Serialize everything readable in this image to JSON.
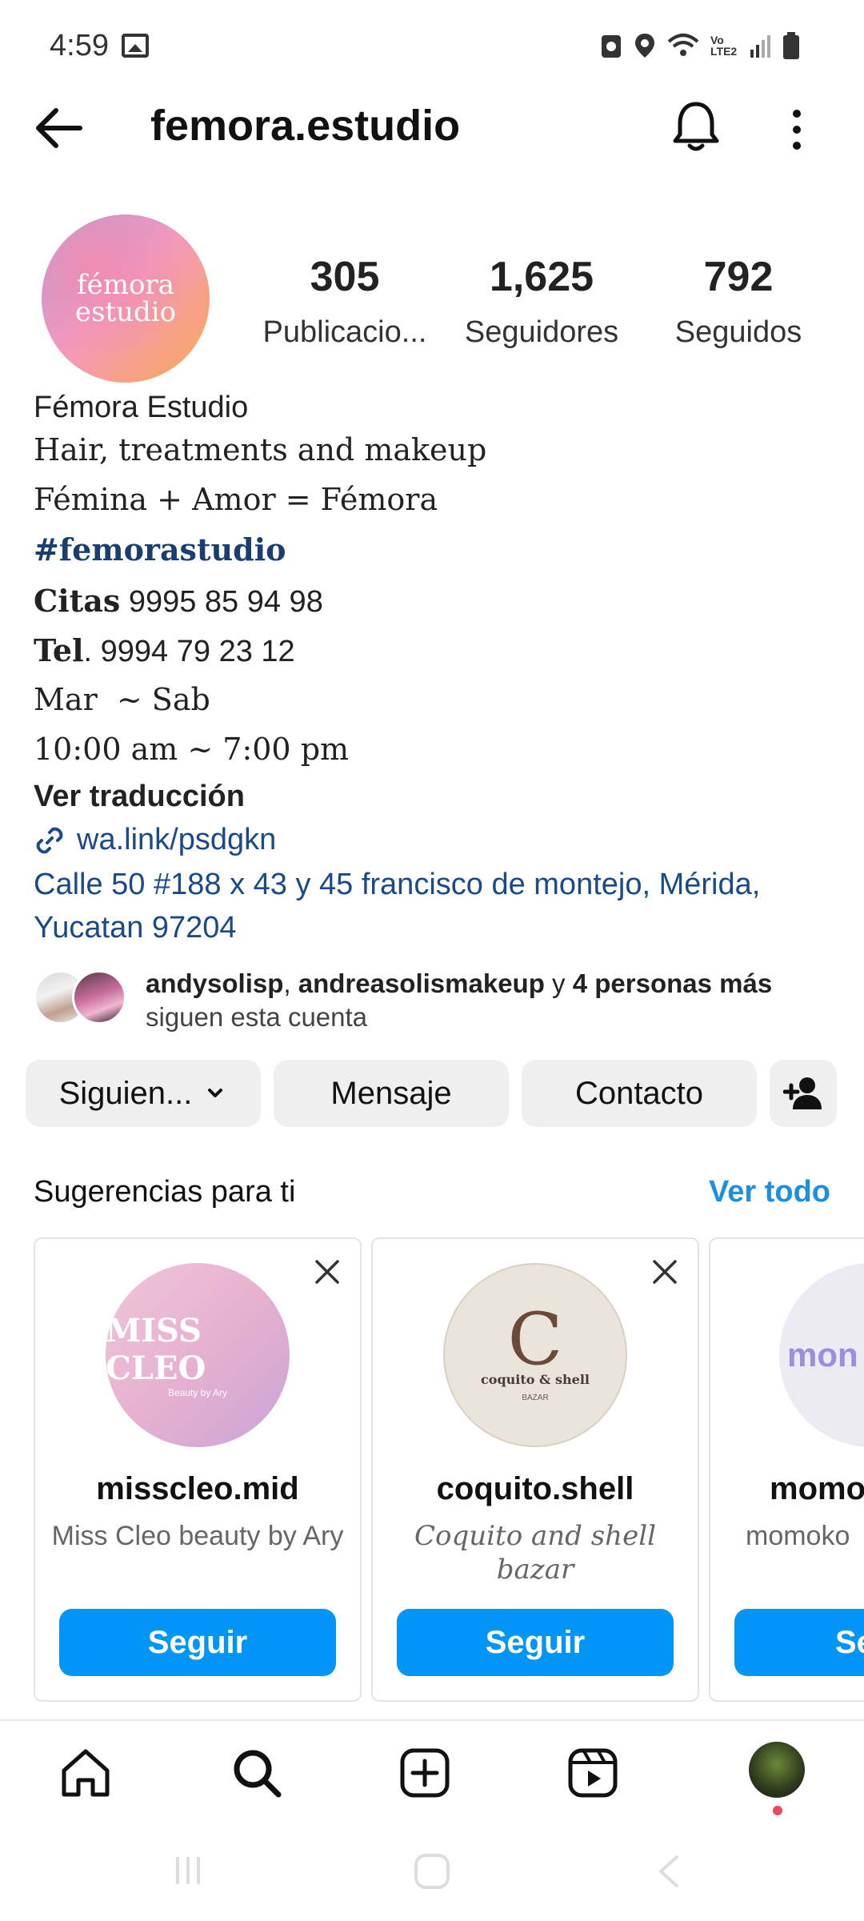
{
  "status_bar": {
    "time": "4:59",
    "network_label": "Vo LTE2"
  },
  "header": {
    "handle": "femora.estudio"
  },
  "profile": {
    "avatar_text_line1": "fémora",
    "avatar_text_line2": "estudio",
    "stats": [
      {
        "value": "305",
        "label": "Publicacio..."
      },
      {
        "value": "1,625",
        "label": "Seguidores"
      },
      {
        "value": "792",
        "label": "Seguidos"
      }
    ],
    "display_name": "Fémora Estudio",
    "bio": {
      "line1": "Hair, treatments and makeup",
      "line2": "Fémina + Amor = Fémora",
      "hashtag": "#femorastudio",
      "citas_label": "Citas",
      "citas_phone": "9995 85 94 98",
      "tel_label": "Tel",
      "tel_phone": ". 9994 79 23 12",
      "days": "Mar  ~ Sab",
      "hours": "10:00 am ~ 7:00 pm"
    },
    "translate": "Ver traducción",
    "link": "wa.link/psdgkn",
    "address": "Calle 50 #188 x 43 y 45 francisco de montejo, Mérida, Yucatan 97204",
    "followed_by": {
      "user1": "andysolisp",
      "separator": ", ",
      "user2": "andreasolismakeup",
      "connector": " y ",
      "more": "4 personas más",
      "line2": "siguen esta cuenta"
    }
  },
  "actions": {
    "following": "Siguien...",
    "message": "Mensaje",
    "contact": "Contacto"
  },
  "suggestions": {
    "title": "Sugerencias para ti",
    "see_all": "Ver todo",
    "items": [
      {
        "username": "misscleo.mid",
        "name": "Miss Cleo beauty by Ary",
        "button": "Seguir",
        "avatar_text": "MISS CLEO",
        "avatar_sub": "Beauty by Ary"
      },
      {
        "username": "coquito.shell",
        "name": "Coquito and shell bazar",
        "button": "Seguir",
        "avatar_text": "coquito & shell",
        "avatar_sub": "BAZAR",
        "avatar_letter": "C"
      },
      {
        "username": "momo",
        "name": "momoko",
        "button": "Se",
        "avatar_text": "mon"
      }
    ]
  },
  "colors": {
    "accent_blue": "#0095f6",
    "link_blue": "#1a4a88",
    "see_all_blue": "#1d8fe0",
    "notification_dot": "#ed4956"
  }
}
